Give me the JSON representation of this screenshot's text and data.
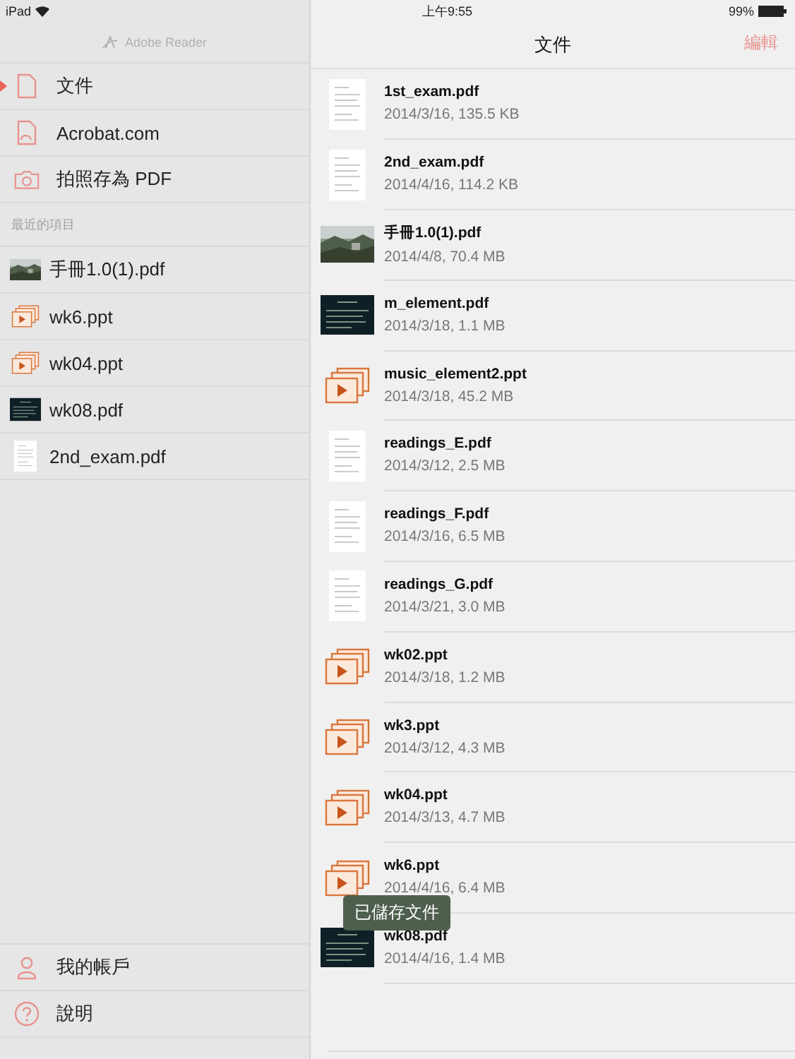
{
  "status_bar": {
    "device": "iPad",
    "time": "上午9:55",
    "battery": "99%"
  },
  "sidebar": {
    "app_title": "Adobe Reader",
    "nav": [
      {
        "label": "文件",
        "kind": "document",
        "selected": true
      },
      {
        "label": "Acrobat.com",
        "kind": "cloud",
        "selected": false
      },
      {
        "label": "拍照存為 PDF",
        "kind": "camera",
        "selected": false
      }
    ],
    "recent_heading": "最近的項目",
    "recent": [
      {
        "name": "手冊1.0(1).pdf"
      },
      {
        "name": "wk6.ppt",
        "kind": "ppt"
      },
      {
        "name": "wk04.ppt",
        "kind": "ppt"
      },
      {
        "name": "wk08.pdf",
        "kind": "slide"
      },
      {
        "name": "2nd_exam.pdf",
        "kind": "page"
      }
    ],
    "footer": [
      {
        "label": "我的帳戶",
        "kind": "account"
      },
      {
        "label": "說明",
        "kind": "help"
      }
    ]
  },
  "main": {
    "title": "文件",
    "edit_button": "編輯",
    "files": [
      {
        "name": "1st_exam.pdf",
        "info": "2014/3/16, 135.5 KB",
        "kind": "page"
      },
      {
        "name": "2nd_exam.pdf",
        "info": "2014/4/16, 114.2 KB",
        "kind": "page"
      },
      {
        "name": "手冊1.0(1).pdf",
        "info": "2014/4/8, 70.4 MB"
      },
      {
        "name": "m_element.pdf",
        "info": "2014/3/18, 1.1 MB",
        "kind": "slide"
      },
      {
        "name": "music_element2.ppt",
        "info": "2014/3/18, 45.2 MB",
        "kind": "ppt"
      },
      {
        "name": "readings_E.pdf",
        "info": "2014/3/12, 2.5 MB",
        "kind": "page"
      },
      {
        "name": "readings_F.pdf",
        "info": "2014/3/16, 6.5 MB",
        "kind": "page"
      },
      {
        "name": "readings_G.pdf",
        "info": "2014/3/21, 3.0 MB",
        "kind": "page"
      },
      {
        "name": "wk02.ppt",
        "info": "2014/3/18, 1.2 MB",
        "kind": "ppt"
      },
      {
        "name": "wk3.ppt",
        "info": "2014/3/12, 4.3 MB",
        "kind": "ppt"
      },
      {
        "name": "wk04.ppt",
        "info": "2014/3/13, 4.7 MB",
        "kind": "ppt"
      },
      {
        "name": "wk6.ppt",
        "info": "2014/4/16, 6.4 MB",
        "kind": "ppt"
      },
      {
        "name": "wk08.pdf",
        "info": "2014/4/16, 1.4 MB",
        "kind": "slide"
      }
    ],
    "toast": "已儲存文件"
  }
}
